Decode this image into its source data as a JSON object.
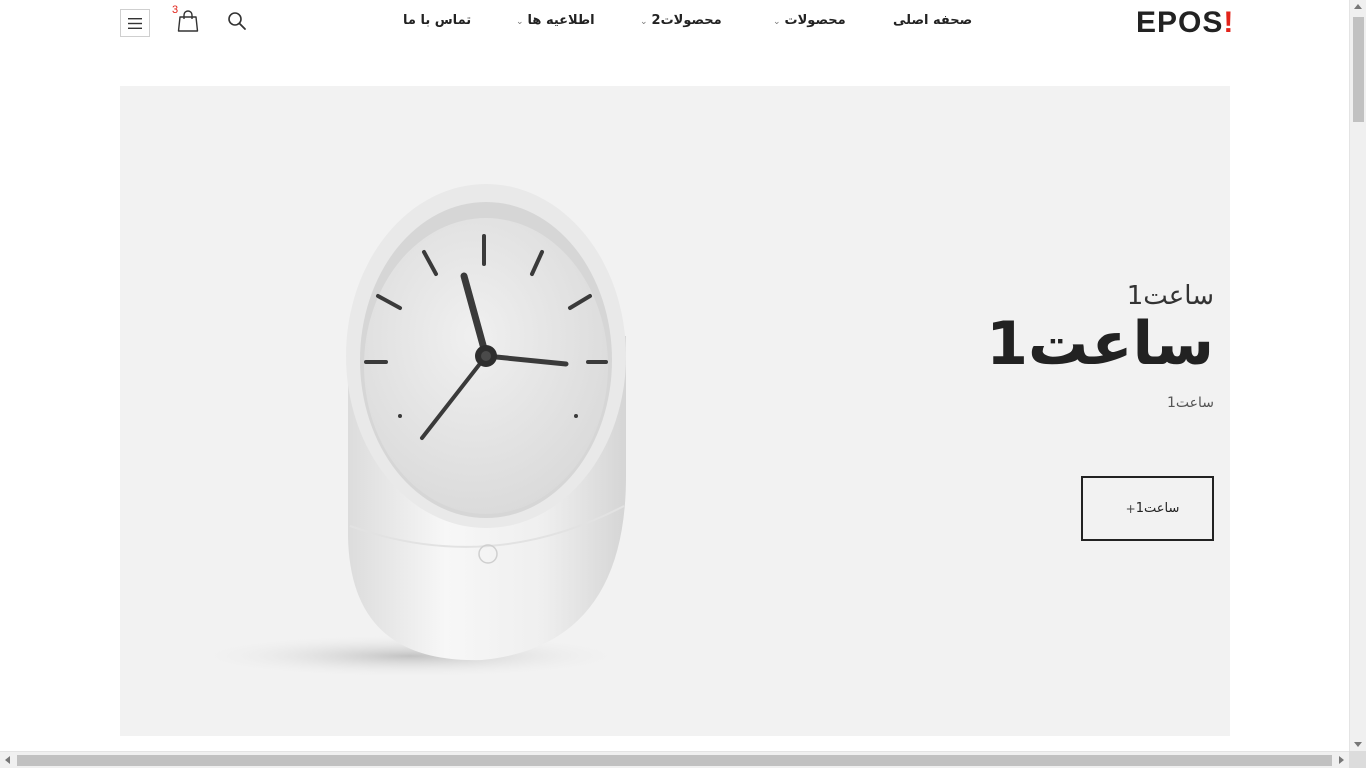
{
  "header": {
    "logo_text": "EPOS",
    "logo_mark": "!",
    "cart_count": "3",
    "nav": {
      "home": "صحفه اصلی",
      "products": "محصولات",
      "products2": "محصولات2",
      "news": "اطلاعیه ها",
      "contact": "تماس با ما"
    },
    "icons": {
      "menu": "hamburger-menu-icon",
      "cart": "shopping-bag-icon",
      "search": "search-icon"
    }
  },
  "hero": {
    "subtitle": "ساعت1",
    "title": "ساعت1",
    "description": "ساعت1",
    "button_label": "ساعت1",
    "button_icon": "+",
    "image": "white-desk-clock"
  },
  "colors": {
    "accent": "#e2231a",
    "hero_bg": "#f2f2f2",
    "text": "#222222"
  }
}
